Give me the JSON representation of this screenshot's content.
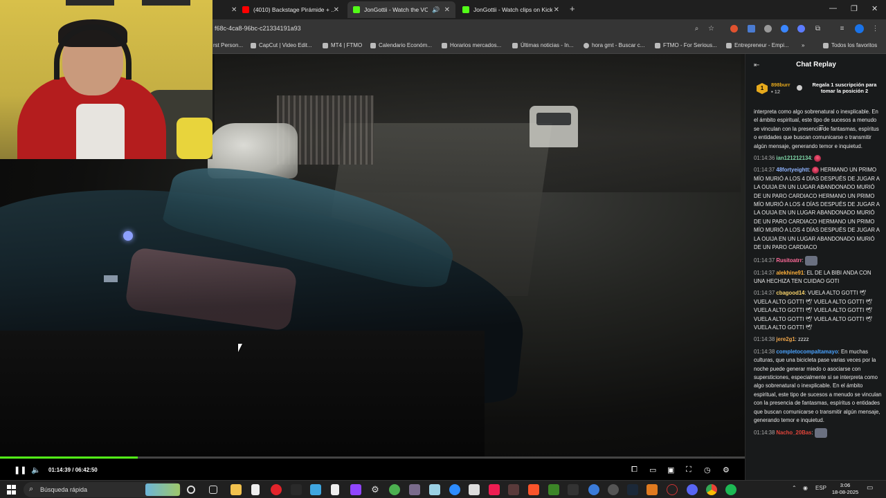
{
  "browser": {
    "tabs": [
      {
        "label": "(4010) Backstage Pirámide + ...",
        "favicon": "youtube-icon",
        "color": "#ff0000"
      },
      {
        "label": "JonGottii - Watch the VOD",
        "favicon": "kick-icon",
        "color": "#53fc18",
        "active": true
      },
      {
        "label": "JonGottii - Watch clips on Kick",
        "favicon": "kick-icon",
        "color": "#53fc18"
      }
    ],
    "url": "f68c-4ca8-96bc-c21334191a93",
    "bookmarks": [
      "rst Person...",
      "CapCut | Video Edit...",
      "MT4 | FTMO",
      "Calendario Económ...",
      "Horarios mercados...",
      "Últimas noticias - In...",
      "hora gmt - Buscar c...",
      "FTMO - For Serious...",
      "Entrepreneur - Empi..."
    ],
    "bookmarks_more": "»",
    "all_bookmarks": "Todos los favoritos"
  },
  "player": {
    "time": "01:14:39 / 06:42:50",
    "progress": 0.185,
    "accent": "#53fc18"
  },
  "chat": {
    "title": "Chat Replay",
    "pinned": {
      "rank": "1",
      "user": "898burr",
      "count": "12",
      "text": "Regala 1 suscripción para tomar la posición 2"
    },
    "messages": [
      {
        "ts": "",
        "user": "",
        "color": "#ffffff",
        "text": "interpreta como algo sobrenatural o inexplicable. En el ámbito espiritual, este tipo de sucesos a menudo se vinculan con la presencia de fantasmas, espíritus o entidades que buscan comunicarse o transmitir algún mensaje, generando temor e inquietud."
      },
      {
        "ts": "01:14:36",
        "user": "ian121212134",
        "color": "#7fd7a8",
        "text": "",
        "emote": true
      },
      {
        "ts": "01:14:37",
        "user": "48fortyeightt",
        "color": "#8fb3ff",
        "text": "HERMANO UN PRIMO MÍO MURIÓ A LOS 4 DÍAS DESPUÉS DE JUGAR A LA OUIJA EN UN LUGAR ABANDONADO MURIÓ DE UN PARO CARDIACO HERMANO UN PRIMO MÍO MURIÓ A LOS 4 DÍAS DESPUÉS DE JUGAR A LA OUIJA EN UN LUGAR ABANDONADO MURIÓ DE UN PARO CARDIACO HERMANO UN PRIMO MÍO MURIÓ A LOS 4 DÍAS DESPUÉS DE JUGAR A LA OUIJA EN UN LUGAR ABANDONADO MURIÓ DE UN PARO CARDIACO",
        "emote": true
      },
      {
        "ts": "01:14:37",
        "user": "Rusitoatrr",
        "color": "#ff6b9a",
        "text": "",
        "emote_img": true
      },
      {
        "ts": "01:14:37",
        "user": "alekhine91",
        "color": "#ffb13b",
        "text": "EL DE LA BIBI ANDA CON UNA HECHIZA TEN CUIDAO GOTI"
      },
      {
        "ts": "01:14:37",
        "user": "cbagood14",
        "color": "#f7d26b",
        "text": "VUELA ALTO GOTTI 🕊 VUELA ALTO GOTTI 🕊 VUELA ALTO GOTTI 🕊 VUELA ALTO GOTTI 🕊 VUELA ALTO GOTTI 🕊 VUELA ALTO GOTTI 🕊 VUELA ALTO GOTTI 🕊 VUELA ALTO GOTTI 🕊"
      },
      {
        "ts": "01:14:38",
        "user": "jere2g1",
        "color": "#f0a64a",
        "text": "zzzz"
      },
      {
        "ts": "01:14:38",
        "user": "completocompaltamayo",
        "color": "#4aa3ff",
        "text": "En muchas culturas, que una bicicleta pase varias veces por la noche puede generar miedo o asociarse con supersticiones, especialmente si se interpreta como algo sobrenatural o inexplicable. En el ámbito espiritual, este tipo de sucesos a menudo se vinculan con la presencia de fantasmas, espíritus o entidades que buscan comunicarse o transmitir algún mensaje, generando temor e inquietud."
      },
      {
        "ts": "01:14:38",
        "user": "Nacho_20Bas",
        "color": "#e0443a",
        "text": "",
        "emote_img": true
      }
    ]
  },
  "taskbar": {
    "search_label": "Búsqueda rápida",
    "lang": "ESP",
    "time": "3:06",
    "date": "18-08-2025"
  }
}
